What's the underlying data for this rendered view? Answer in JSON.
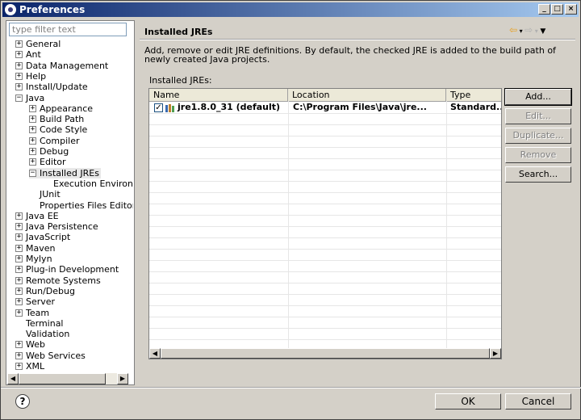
{
  "window": {
    "title": "Preferences"
  },
  "filter": {
    "placeholder": "type filter text"
  },
  "tree": [
    {
      "label": "General",
      "level": 0,
      "toggle": "+"
    },
    {
      "label": "Ant",
      "level": 0,
      "toggle": "+"
    },
    {
      "label": "Data Management",
      "level": 0,
      "toggle": "+"
    },
    {
      "label": "Help",
      "level": 0,
      "toggle": "+"
    },
    {
      "label": "Install/Update",
      "level": 0,
      "toggle": "+"
    },
    {
      "label": "Java",
      "level": 0,
      "toggle": "-"
    },
    {
      "label": "Appearance",
      "level": 1,
      "toggle": "+"
    },
    {
      "label": "Build Path",
      "level": 1,
      "toggle": "+"
    },
    {
      "label": "Code Style",
      "level": 1,
      "toggle": "+"
    },
    {
      "label": "Compiler",
      "level": 1,
      "toggle": "+"
    },
    {
      "label": "Debug",
      "level": 1,
      "toggle": "+"
    },
    {
      "label": "Editor",
      "level": 1,
      "toggle": "+"
    },
    {
      "label": "Installed JREs",
      "level": 1,
      "toggle": "-",
      "selected": true
    },
    {
      "label": "Execution Environments",
      "level": 2,
      "toggle": ""
    },
    {
      "label": "JUnit",
      "level": 1,
      "toggle": ""
    },
    {
      "label": "Properties Files Editor",
      "level": 1,
      "toggle": ""
    },
    {
      "label": "Java EE",
      "level": 0,
      "toggle": "+"
    },
    {
      "label": "Java Persistence",
      "level": 0,
      "toggle": "+"
    },
    {
      "label": "JavaScript",
      "level": 0,
      "toggle": "+"
    },
    {
      "label": "Maven",
      "level": 0,
      "toggle": "+"
    },
    {
      "label": "Mylyn",
      "level": 0,
      "toggle": "+"
    },
    {
      "label": "Plug-in Development",
      "level": 0,
      "toggle": "+"
    },
    {
      "label": "Remote Systems",
      "level": 0,
      "toggle": "+"
    },
    {
      "label": "Run/Debug",
      "level": 0,
      "toggle": "+"
    },
    {
      "label": "Server",
      "level": 0,
      "toggle": "+"
    },
    {
      "label": "Team",
      "level": 0,
      "toggle": "+"
    },
    {
      "label": "Terminal",
      "level": 0,
      "toggle": ""
    },
    {
      "label": "Validation",
      "level": 0,
      "toggle": ""
    },
    {
      "label": "Web",
      "level": 0,
      "toggle": "+"
    },
    {
      "label": "Web Services",
      "level": 0,
      "toggle": "+"
    },
    {
      "label": "XML",
      "level": 0,
      "toggle": "+"
    }
  ],
  "page": {
    "title": "Installed JREs",
    "description": "Add, remove or edit JRE definitions. By default, the checked JRE is added to the build path of newly created Java projects.",
    "table_label": "Installed JREs:"
  },
  "table": {
    "columns": [
      "Name",
      "Location",
      "Type"
    ],
    "rows": [
      {
        "name": "jre1.8.0_31 (default)",
        "location": "C:\\Program Files\\Java\\jre...",
        "type": "Standard...",
        "checked": true
      }
    ]
  },
  "buttons": {
    "add": "Add...",
    "edit": "Edit...",
    "duplicate": "Duplicate...",
    "remove": "Remove",
    "search": "Search..."
  },
  "footer": {
    "ok": "OK",
    "cancel": "Cancel",
    "help": "?"
  },
  "icons": {
    "back": "back-arrow-icon",
    "forward": "forward-arrow-icon",
    "menu": "view-menu-icon"
  }
}
